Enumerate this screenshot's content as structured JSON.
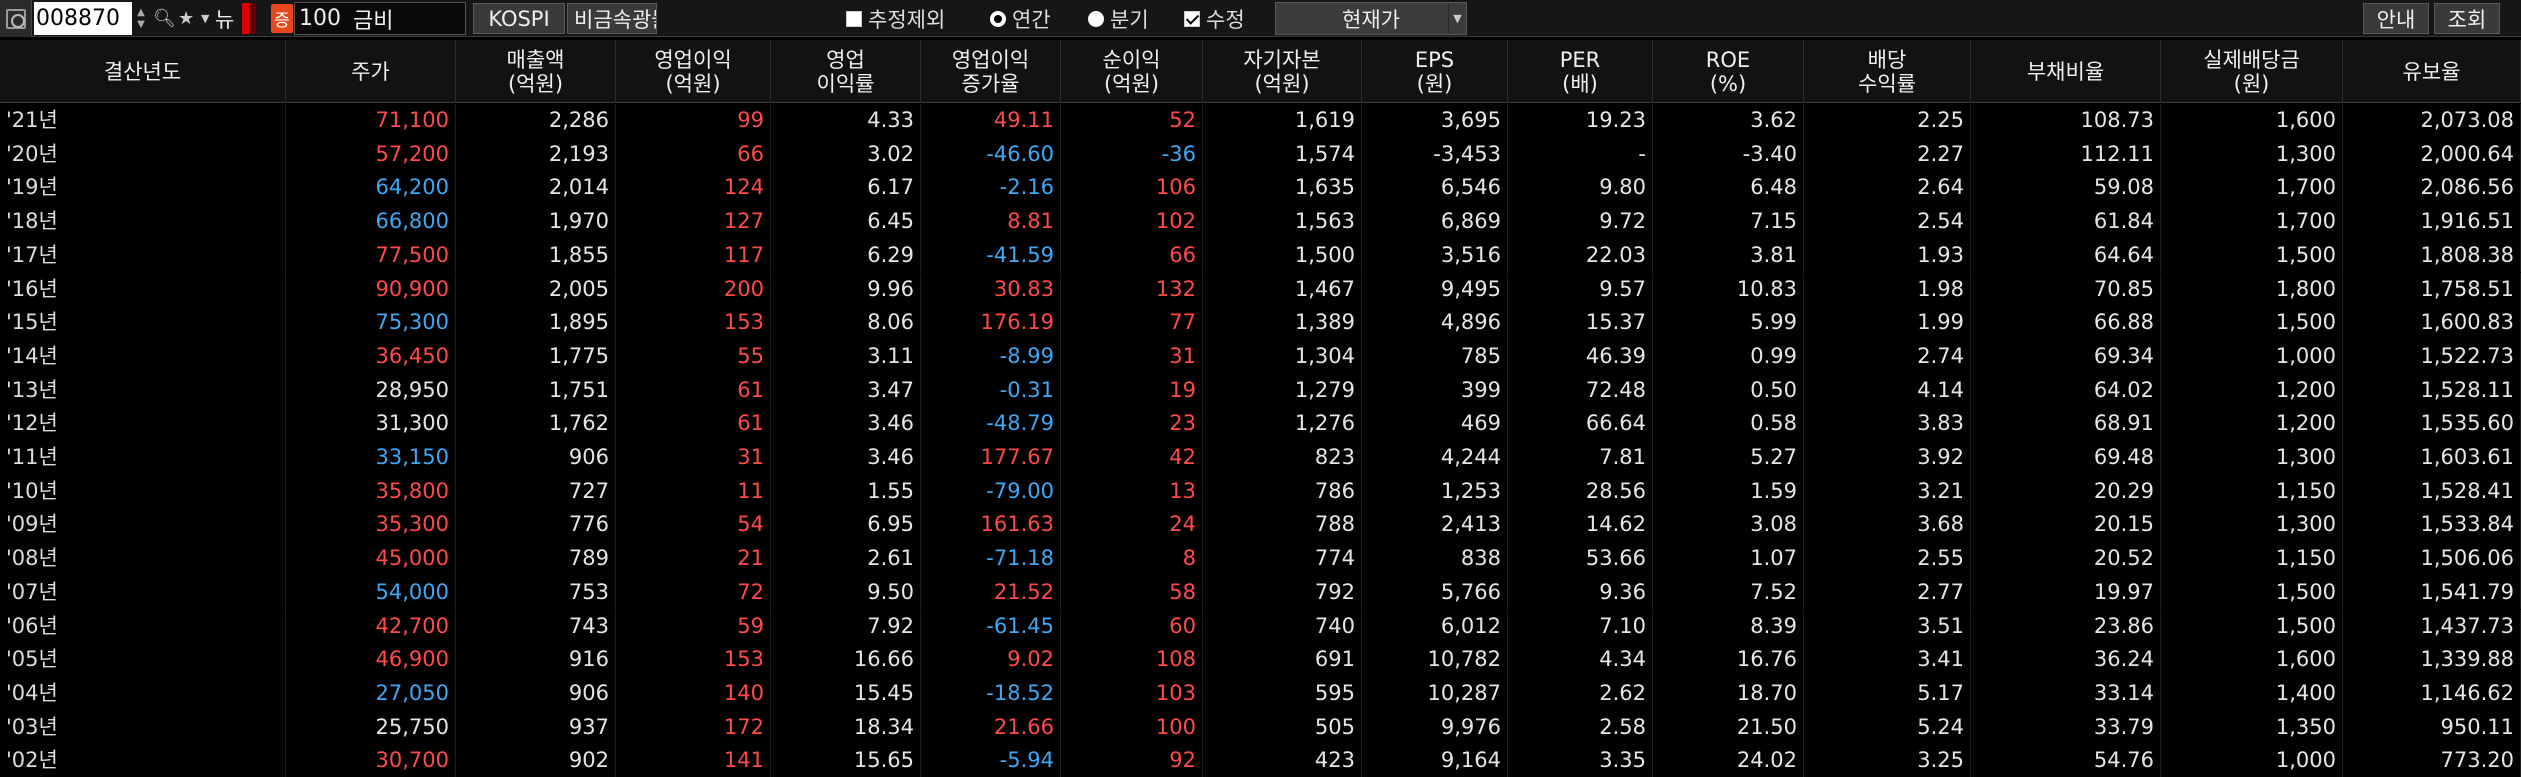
{
  "toolbar": {
    "stock_code": "008870",
    "name_prefix": "100",
    "name": "금비",
    "badge_left": "뉴",
    "badge_ma": "증",
    "market": "KOSPI",
    "sector": "비금속광물",
    "opt_exclude_estimate": "추정제외",
    "opt_annual": "연간",
    "opt_quarter": "분기",
    "opt_adjusted": "수정",
    "price_type": "현재가",
    "guide_label": "안내",
    "query_label": "조회"
  },
  "columns": [
    "결산년도",
    "주가",
    "매출액\n(억원)",
    "영업이익\n(억원)",
    "영업\n이익률",
    "영업이익\n증가율",
    "순이익\n(억원)",
    "자기자본\n(억원)",
    "EPS\n(원)",
    "PER\n(배)",
    "ROE\n(%)",
    "배당\n수익률",
    "부채비율",
    "실제배당금\n(원)",
    "유보율"
  ],
  "rows": [
    [
      "'21년",
      "71,100",
      "2,286",
      "99",
      "4.33",
      "49.11",
      "52",
      "1,619",
      "3,695",
      "19.23",
      "3.62",
      "2.25",
      "108.73",
      "1,600",
      "2,073.08"
    ],
    [
      "'20년",
      "57,200",
      "2,193",
      "66",
      "3.02",
      "-46.60",
      "-36",
      "1,574",
      "-3,453",
      "-",
      "-3.40",
      "2.27",
      "112.11",
      "1,300",
      "2,000.64"
    ],
    [
      "'19년",
      "64,200",
      "2,014",
      "124",
      "6.17",
      "-2.16",
      "106",
      "1,635",
      "6,546",
      "9.80",
      "6.48",
      "2.64",
      "59.08",
      "1,700",
      "2,086.56"
    ],
    [
      "'18년",
      "66,800",
      "1,970",
      "127",
      "6.45",
      "8.81",
      "102",
      "1,563",
      "6,869",
      "9.72",
      "7.15",
      "2.54",
      "61.84",
      "1,700",
      "1,916.51"
    ],
    [
      "'17년",
      "77,500",
      "1,855",
      "117",
      "6.29",
      "-41.59",
      "66",
      "1,500",
      "3,516",
      "22.03",
      "3.81",
      "1.93",
      "64.64",
      "1,500",
      "1,808.38"
    ],
    [
      "'16년",
      "90,900",
      "2,005",
      "200",
      "9.96",
      "30.83",
      "132",
      "1,467",
      "9,495",
      "9.57",
      "10.83",
      "1.98",
      "70.85",
      "1,800",
      "1,758.51"
    ],
    [
      "'15년",
      "75,300",
      "1,895",
      "153",
      "8.06",
      "176.19",
      "77",
      "1,389",
      "4,896",
      "15.37",
      "5.99",
      "1.99",
      "66.88",
      "1,500",
      "1,600.83"
    ],
    [
      "'14년",
      "36,450",
      "1,775",
      "55",
      "3.11",
      "-8.99",
      "31",
      "1,304",
      "785",
      "46.39",
      "0.99",
      "2.74",
      "69.34",
      "1,000",
      "1,522.73"
    ],
    [
      "'13년",
      "28,950",
      "1,751",
      "61",
      "3.47",
      "-0.31",
      "19",
      "1,279",
      "399",
      "72.48",
      "0.50",
      "4.14",
      "64.02",
      "1,200",
      "1,528.11"
    ],
    [
      "'12년",
      "31,300",
      "1,762",
      "61",
      "3.46",
      "-48.79",
      "23",
      "1,276",
      "469",
      "66.64",
      "0.58",
      "3.83",
      "68.91",
      "1,200",
      "1,535.60"
    ],
    [
      "'11년",
      "33,150",
      "906",
      "31",
      "3.46",
      "177.67",
      "42",
      "823",
      "4,244",
      "7.81",
      "5.27",
      "3.92",
      "69.48",
      "1,300",
      "1,603.61"
    ],
    [
      "'10년",
      "35,800",
      "727",
      "11",
      "1.55",
      "-79.00",
      "13",
      "786",
      "1,253",
      "28.56",
      "1.59",
      "3.21",
      "20.29",
      "1,150",
      "1,528.41"
    ],
    [
      "'09년",
      "35,300",
      "776",
      "54",
      "6.95",
      "161.63",
      "24",
      "788",
      "2,413",
      "14.62",
      "3.08",
      "3.68",
      "20.15",
      "1,300",
      "1,533.84"
    ],
    [
      "'08년",
      "45,000",
      "789",
      "21",
      "2.61",
      "-71.18",
      "8",
      "774",
      "838",
      "53.66",
      "1.07",
      "2.55",
      "20.52",
      "1,150",
      "1,506.06"
    ],
    [
      "'07년",
      "54,000",
      "753",
      "72",
      "9.50",
      "21.52",
      "58",
      "792",
      "5,766",
      "9.36",
      "7.52",
      "2.77",
      "19.97",
      "1,500",
      "1,541.79"
    ],
    [
      "'06년",
      "42,700",
      "743",
      "59",
      "7.92",
      "-61.45",
      "60",
      "740",
      "6,012",
      "7.10",
      "8.39",
      "3.51",
      "23.86",
      "1,500",
      "1,437.73"
    ],
    [
      "'05년",
      "46,900",
      "916",
      "153",
      "16.66",
      "9.02",
      "108",
      "691",
      "10,782",
      "4.34",
      "16.76",
      "3.41",
      "36.24",
      "1,600",
      "1,339.88"
    ],
    [
      "'04년",
      "27,050",
      "906",
      "140",
      "15.45",
      "-18.52",
      "103",
      "595",
      "10,287",
      "2.62",
      "18.70",
      "5.17",
      "33.14",
      "1,400",
      "1,146.62"
    ],
    [
      "'03년",
      "25,750",
      "937",
      "172",
      "18.34",
      "21.66",
      "100",
      "505",
      "9,976",
      "2.58",
      "21.50",
      "5.24",
      "33.79",
      "1,350",
      "950.11"
    ],
    [
      "'02년",
      "30,700",
      "902",
      "141",
      "15.65",
      "-5.94",
      "92",
      "423",
      "9,164",
      "3.35",
      "24.02",
      "3.25",
      "54.76",
      "1,000",
      "773.20"
    ]
  ],
  "price_colors": [
    "red",
    "red",
    "blue",
    "blue",
    "red",
    "red",
    "blue",
    "red",
    "white",
    "white",
    "blue",
    "red",
    "red",
    "red",
    "blue",
    "red",
    "red",
    "blue",
    "white",
    "red"
  ],
  "colors": {
    "up": "#ff4a4a",
    "down": "#3fa8f5",
    "neutral": "#e6e6e6"
  }
}
